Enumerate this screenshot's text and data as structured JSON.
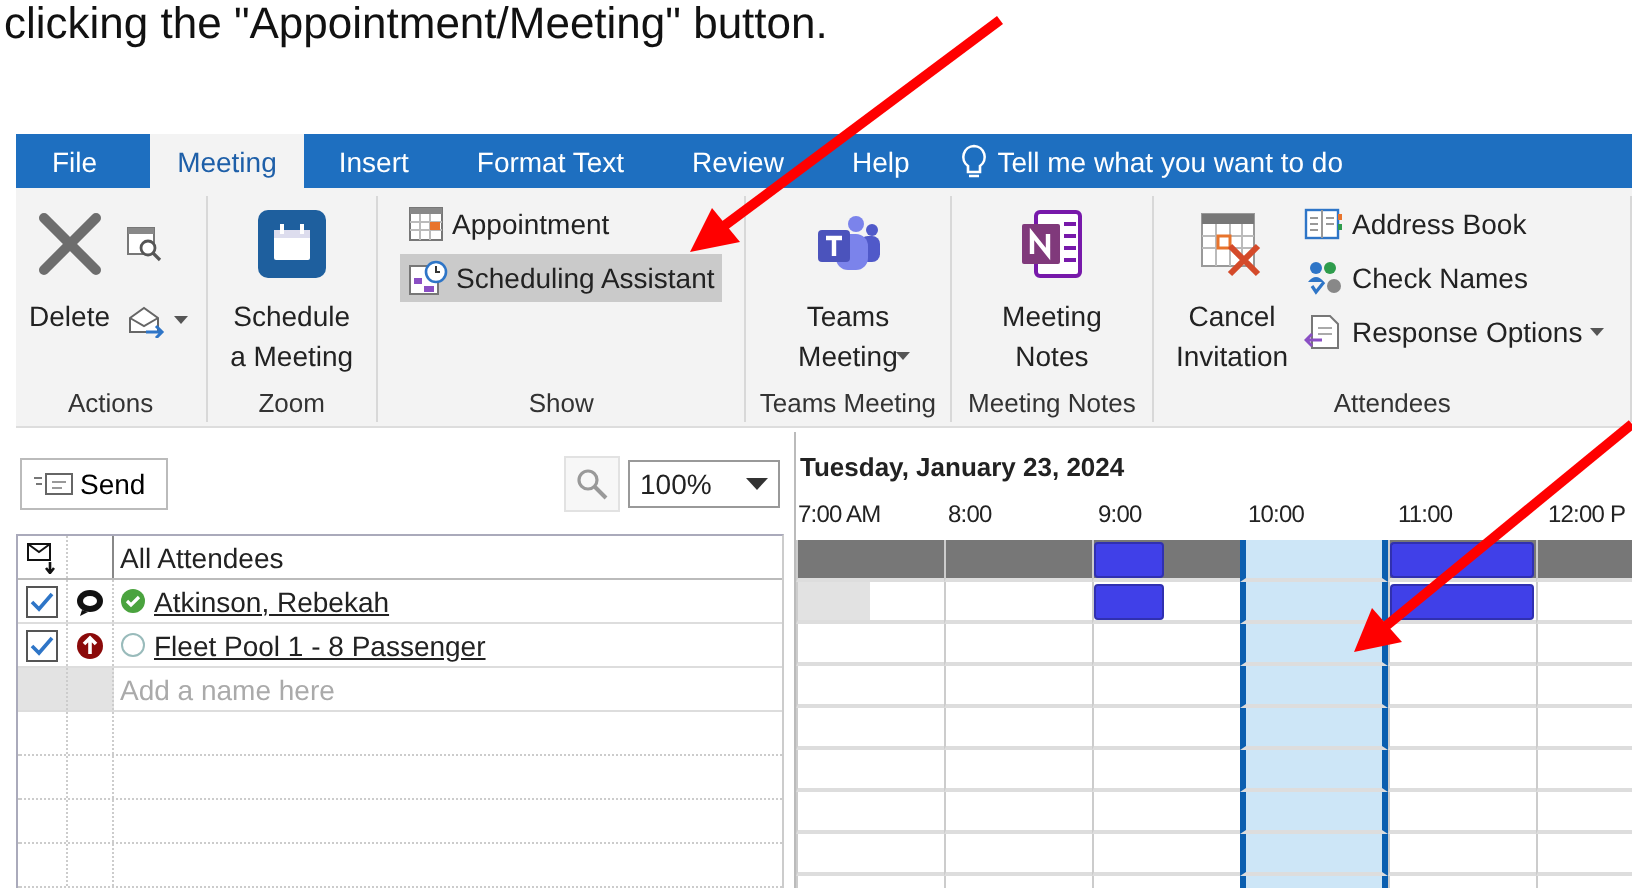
{
  "caption": "clicking the \"Appointment/Meeting\" button.",
  "tabs": [
    {
      "label": "File",
      "selected": false
    },
    {
      "label": "Meeting",
      "selected": true
    },
    {
      "label": "Insert",
      "selected": false
    },
    {
      "label": "Format Text",
      "selected": false
    },
    {
      "label": "Review",
      "selected": false
    },
    {
      "label": "Help",
      "selected": false
    }
  ],
  "tell_me": "Tell me what you want to do",
  "ribbon": {
    "groups": [
      {
        "label": "Actions",
        "items": [
          {
            "kind": "large",
            "label": "Delete"
          },
          {
            "kind": "column",
            "items": [
              {
                "kind": "small"
              },
              {
                "kind": "small",
                "dropdown": true
              }
            ]
          }
        ]
      },
      {
        "label": "Zoom",
        "items": [
          {
            "kind": "large",
            "label": "Schedule\na Meeting"
          }
        ]
      },
      {
        "label": "Show",
        "items": [
          {
            "kind": "column",
            "items": [
              {
                "kind": "small",
                "label": "Appointment",
                "selected": false
              },
              {
                "kind": "small",
                "label": "Scheduling Assistant",
                "selected": true
              }
            ]
          }
        ]
      },
      {
        "label": "Teams Meeting",
        "items": [
          {
            "kind": "large",
            "label": "Teams\nMeeting",
            "dropdown": true
          }
        ]
      },
      {
        "label": "Meeting Notes",
        "items": [
          {
            "kind": "large",
            "label": "Meeting\nNotes"
          }
        ]
      },
      {
        "label": "Attendees",
        "items": [
          {
            "kind": "large",
            "label": "Cancel\nInvitation"
          },
          {
            "kind": "column",
            "items": [
              {
                "kind": "small",
                "label": "Address Book"
              },
              {
                "kind": "small",
                "label": "Check Names"
              },
              {
                "kind": "small",
                "label": "Response Options",
                "dropdown": true
              }
            ]
          }
        ]
      }
    ]
  },
  "send_button": "Send",
  "zoom_value": "100%",
  "attendee_header": "All Attendees",
  "attendees": [
    {
      "name": "Atkinson, Rebekah",
      "checked": true,
      "kind": "organizer",
      "accepted": true
    },
    {
      "name": "Fleet Pool 1 - 8 Passenger",
      "checked": true,
      "kind": "resource",
      "accepted": false
    }
  ],
  "add_placeholder": "Add a name here",
  "schedule": {
    "date": "Tuesday, January 23, 2024",
    "times": [
      "7:00 AM",
      "8:00",
      "9:00",
      "10:00",
      "11:00",
      "12:00 P"
    ],
    "columns": [
      {
        "selected": false
      },
      {
        "selected": false
      },
      {
        "selected": false
      },
      {
        "selected": false
      },
      {
        "selected": false
      },
      {
        "selected": false
      },
      {
        "selected": true
      },
      {
        "selected": true
      },
      {
        "selected": false
      },
      {
        "selected": false
      },
      {
        "selected": false
      },
      {
        "selected": false
      }
    ],
    "rows": [
      {
        "kind": "summary",
        "slots": [
          {
            "kind": "free"
          },
          {
            "kind": "free"
          },
          {
            "kind": "free"
          },
          {
            "kind": "free"
          },
          {
            "kind": "busy"
          },
          {
            "kind": "free"
          },
          {
            "kind": "free"
          },
          {
            "kind": "free"
          },
          {
            "kind": "busy"
          },
          {
            "kind": "busy"
          },
          {
            "kind": "free"
          },
          {
            "kind": "free"
          }
        ]
      },
      {
        "kind": "attendee",
        "slots": [
          {
            "kind": "tentative"
          },
          {
            "kind": "free"
          },
          {
            "kind": "free"
          },
          {
            "kind": "free"
          },
          {
            "kind": "busy"
          },
          {
            "kind": "free"
          },
          {
            "kind": "free"
          },
          {
            "kind": "free"
          },
          {
            "kind": "busy"
          },
          {
            "kind": "busy"
          },
          {
            "kind": "free"
          },
          {
            "kind": "free"
          }
        ]
      },
      {
        "kind": "attendee",
        "slots": [
          {
            "kind": "free"
          },
          {
            "kind": "free"
          },
          {
            "kind": "free"
          },
          {
            "kind": "free"
          },
          {
            "kind": "free"
          },
          {
            "kind": "free"
          },
          {
            "kind": "free"
          },
          {
            "kind": "free"
          },
          {
            "kind": "free"
          },
          {
            "kind": "free"
          },
          {
            "kind": "free"
          },
          {
            "kind": "free"
          }
        ]
      }
    ]
  }
}
